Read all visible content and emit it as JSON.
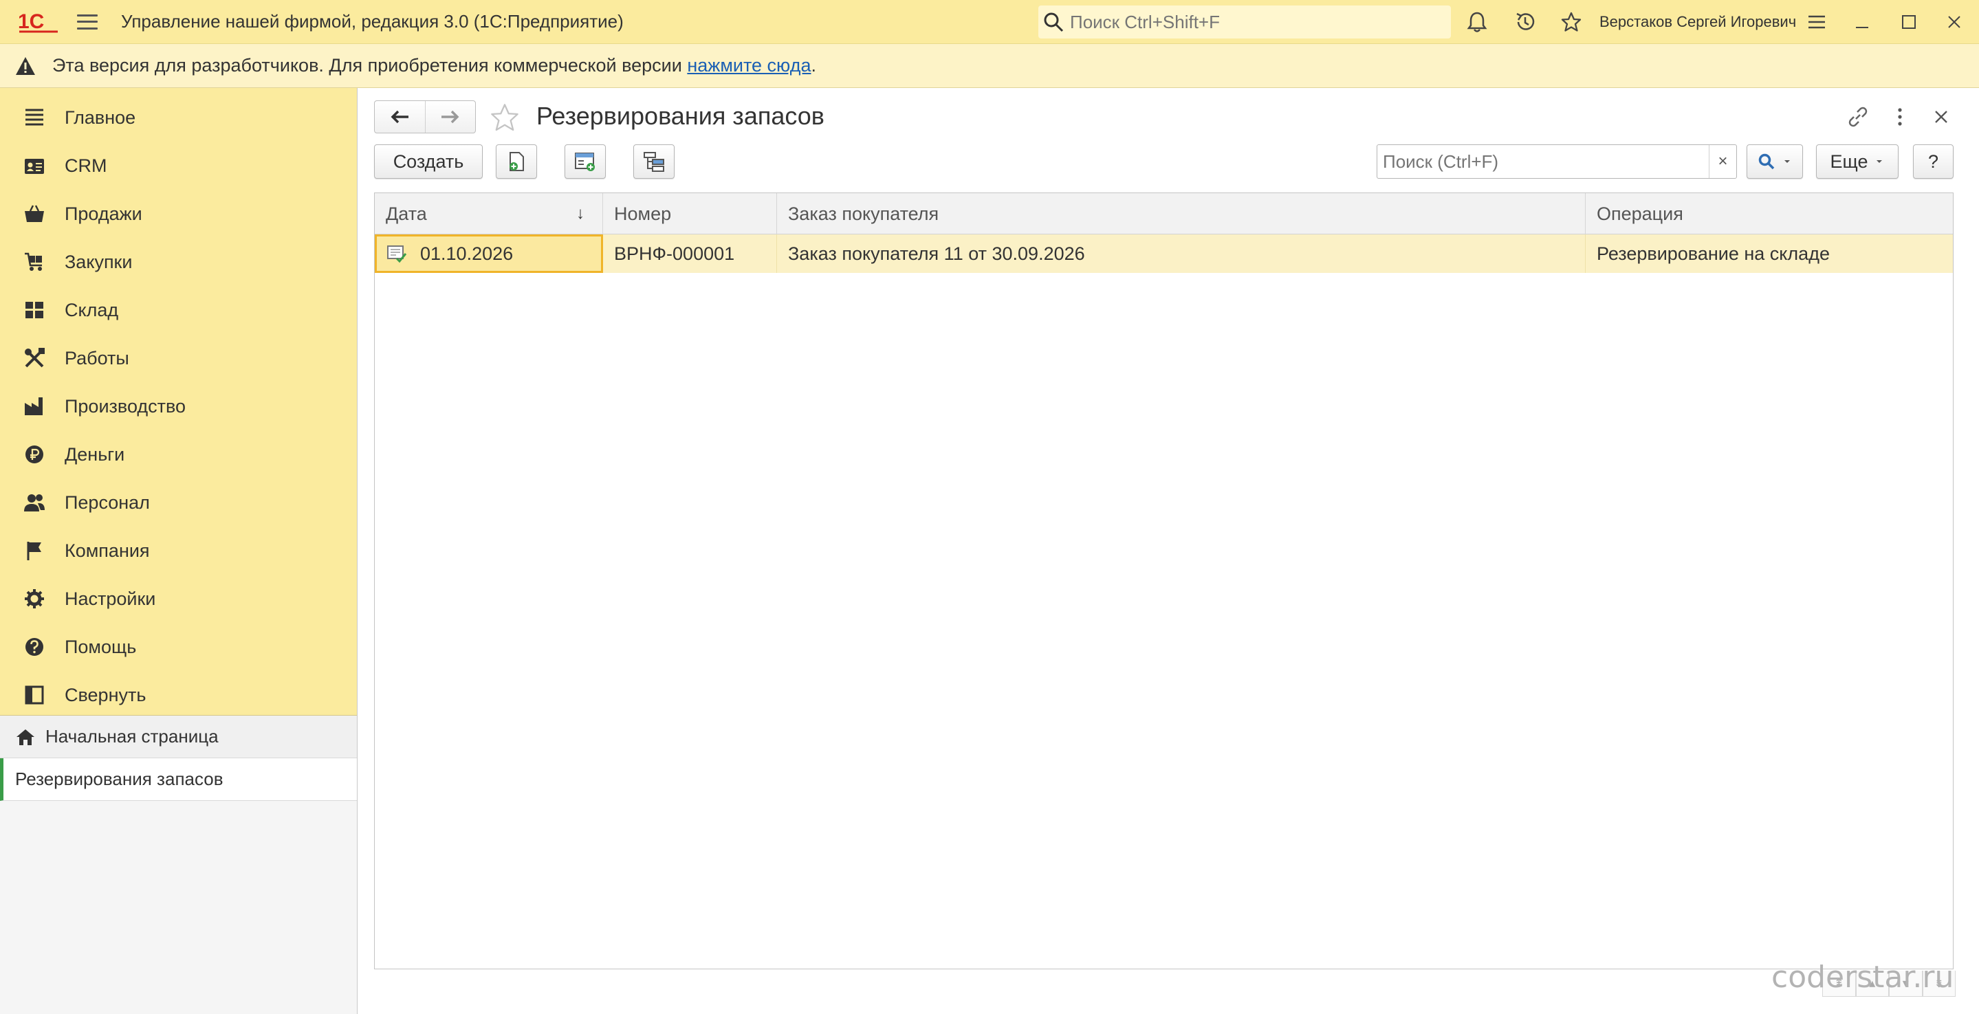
{
  "titlebar": {
    "logo_text": "1С",
    "app_title": "Управление нашей фирмой, редакция 3.0  (1С:Предприятие)",
    "search_placeholder": "Поиск Ctrl+Shift+F",
    "user_name": "Верстаков Сергей Игоревич",
    "brand_color": "#fbeb9e"
  },
  "banner": {
    "text": "Эта версия для разработчиков. Для приобретения коммерческой версии ",
    "link_text": "нажмите сюда",
    "suffix": "."
  },
  "sidebar": {
    "sections": [
      {
        "label": "Главное",
        "icon": "menu-lines-icon"
      },
      {
        "label": "CRM",
        "icon": "contact-card-icon"
      },
      {
        "label": "Продажи",
        "icon": "basket-icon"
      },
      {
        "label": "Закупки",
        "icon": "cart-icon"
      },
      {
        "label": "Склад",
        "icon": "warehouse-grid-icon"
      },
      {
        "label": "Работы",
        "icon": "tools-icon"
      },
      {
        "label": "Производство",
        "icon": "factory-icon"
      },
      {
        "label": "Деньги",
        "icon": "ruble-coin-icon"
      },
      {
        "label": "Персонал",
        "icon": "people-icon"
      },
      {
        "label": "Компания",
        "icon": "flag-icon"
      },
      {
        "label": "Настройки",
        "icon": "gear-icon"
      },
      {
        "label": "Помощь",
        "icon": "help-circle-icon"
      },
      {
        "label": "Свернуть",
        "icon": "collapse-panel-icon"
      }
    ],
    "open_windows": {
      "home": "Начальная страница",
      "current": "Резервирования запасов"
    }
  },
  "form": {
    "title": "Резервирования запасов",
    "create_label": "Создать",
    "search_placeholder": "Поиск (Ctrl+F)",
    "clear_label": "×",
    "more_label": "Еще",
    "help_label": "?"
  },
  "table": {
    "columns": [
      "Дата",
      "Номер",
      "Заказ покупателя",
      "Операция"
    ],
    "sort_indicator": "↓",
    "rows": [
      {
        "date": "01.10.2026",
        "number": "ВРНФ-000001",
        "order": "Заказ покупателя 11 от 30.09.2026",
        "operation": "Резервирование на складе"
      }
    ]
  },
  "watermark": "coderstar.ru"
}
